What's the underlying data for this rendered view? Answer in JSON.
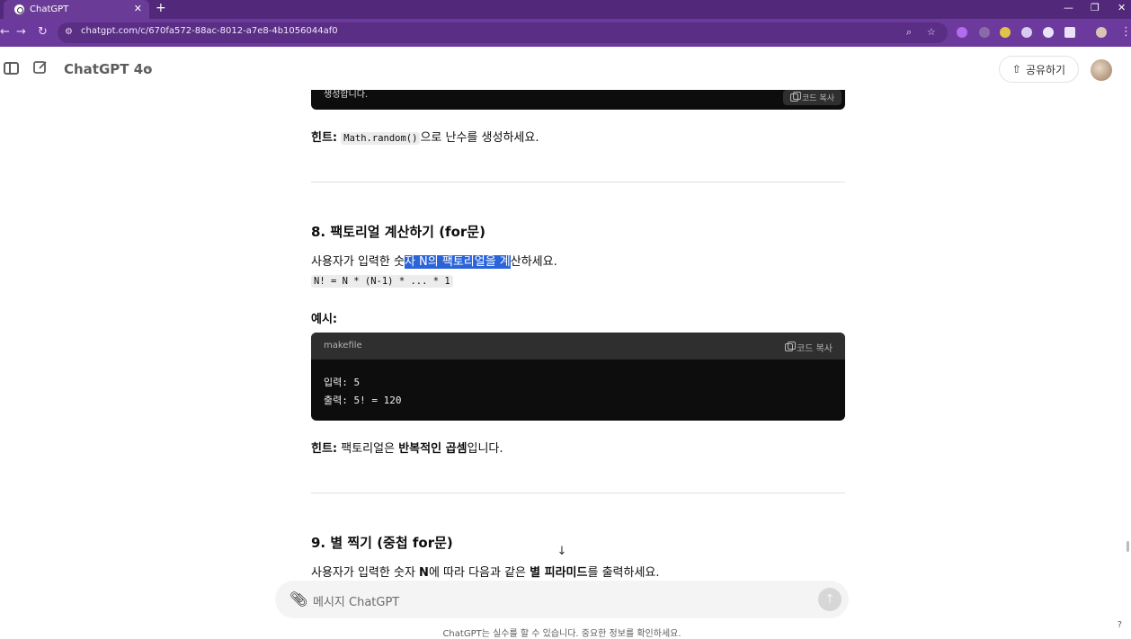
{
  "browser": {
    "tab_title": "ChatGPT",
    "tab_close": "✕",
    "new_tab": "+",
    "url": "chatgpt.com/c/670fa572-88ac-8012-a7e8-4b1056044af0",
    "window_controls": {
      "minimize": "—",
      "maximize": "❐",
      "close": "✕"
    }
  },
  "header": {
    "model_name": "ChatGPT 4o",
    "share_label": "공유하기"
  },
  "content": {
    "top_code_copy_label": "코드 복사",
    "top_code_visible_text": "생성합니다.",
    "hint1_label": "힌트:",
    "hint1_code": "Math.random()",
    "hint1_text": "으로 난수를 생성하세요.",
    "section8_title": "8. 팩토리얼 계산하기 (for문)",
    "section8_desc_pre": "사용자가 입력한 숫",
    "section8_desc_hl": "자 N의 팩토리얼을 계",
    "section8_desc_post": "산하세요.",
    "section8_formula": "N! = N * (N-1) * ... * 1",
    "example_label": "예시:",
    "code_lang": "makefile",
    "code_copy_label": "코드 복사",
    "code_lines": [
      "입력: 5",
      "출력: 5! = 120"
    ],
    "hint2_label": "힌트:",
    "hint2_pre": "팩토리얼은 ",
    "hint2_bold": "반복적인 곱셈",
    "hint2_post": "입니다.",
    "section9_title": "9. 별 찍기 (중첩 for문)",
    "section9_desc_pre": "사용자가 입력한 숫자 ",
    "section9_desc_n": "N",
    "section9_desc_mid": "에 따라 다음과 같은 ",
    "section9_desc_bold": "별 피라미드",
    "section9_desc_post": "를 출력하세요."
  },
  "composer": {
    "placeholder": "메시지 ChatGPT",
    "disclaimer": "ChatGPT는 실수를 할 수 있습니다. 중요한 정보를 확인하세요.",
    "help": "?"
  }
}
